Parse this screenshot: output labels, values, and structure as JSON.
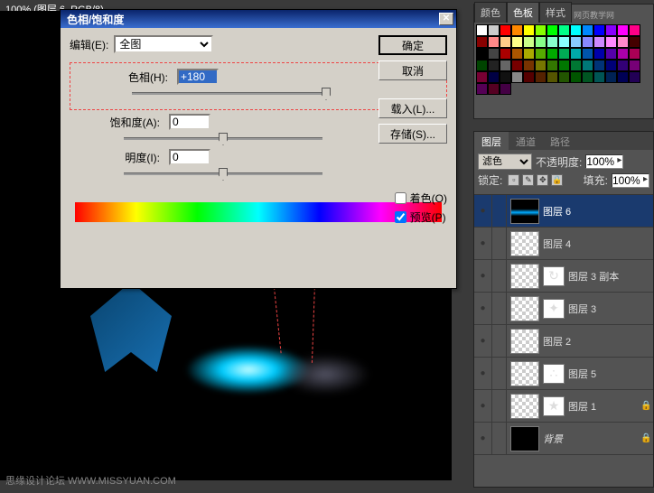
{
  "topbar": "100% (图层 6, RGB/8)",
  "dialog": {
    "title": "色相/饱和度",
    "edit_label": "编辑(E):",
    "edit_value": "全图",
    "hue_label": "色相(H):",
    "hue_value": "+180",
    "sat_label": "饱和度(A):",
    "sat_value": "0",
    "light_label": "明度(I):",
    "light_value": "0",
    "colorize_label": "着色(O)",
    "preview_label": "预览(P)",
    "buttons": {
      "ok": "确定",
      "cancel": "取消",
      "load": "载入(L)...",
      "save": "存储(S)..."
    }
  },
  "swatch_tabs": {
    "color": "颜色",
    "swatch": "色板",
    "style": "样式",
    "ad": "网页教学网"
  },
  "swatch_colors": [
    "#fff",
    "#ccc",
    "#f00",
    "#f80",
    "#ff0",
    "#8f0",
    "#0f0",
    "#0f8",
    "#0ff",
    "#08f",
    "#00f",
    "#80f",
    "#f0f",
    "#f08",
    "#800",
    "#f88",
    "#fc8",
    "#ff8",
    "#cf8",
    "#8f8",
    "#8fc",
    "#8ff",
    "#8cf",
    "#88f",
    "#c8f",
    "#f8f",
    "#f8c",
    "#400",
    "#000",
    "#444",
    "#a00",
    "#a50",
    "#aa0",
    "#5a0",
    "#0a0",
    "#0a5",
    "#0aa",
    "#05a",
    "#00a",
    "#50a",
    "#a0a",
    "#a05",
    "#040",
    "#222",
    "#666",
    "#700",
    "#730",
    "#770",
    "#370",
    "#070",
    "#073",
    "#077",
    "#037",
    "#007",
    "#307",
    "#707",
    "#703",
    "#004",
    "#111",
    "#888",
    "#500",
    "#520",
    "#550",
    "#250",
    "#050",
    "#052",
    "#055",
    "#025",
    "#005",
    "#205",
    "#505",
    "#502",
    "#404"
  ],
  "layers_panel": {
    "tabs": {
      "layers": "图层",
      "channels": "通道",
      "paths": "路径"
    },
    "blend_label": "",
    "blend_value": "滤色",
    "opacity_label": "不透明度:",
    "opacity_value": "100%",
    "lock_label": "锁定:",
    "fill_label": "填充:",
    "fill_value": "100%",
    "layers": [
      {
        "name": "图层 6",
        "sel": true,
        "thumb": "grad"
      },
      {
        "name": "图层 4",
        "thumb": "check"
      },
      {
        "name": "图层 3 副本",
        "thumb": "check",
        "mask": "↻"
      },
      {
        "name": "图层 3",
        "thumb": "check",
        "mask": "✦"
      },
      {
        "name": "图层 2",
        "thumb": "check"
      },
      {
        "name": "图层 5",
        "thumb": "check",
        "mask": "∴"
      },
      {
        "name": "图层 1",
        "thumb": "check",
        "mask": "★",
        "lock": true
      },
      {
        "name": "背景",
        "thumb": "black",
        "italic": true,
        "lock": true
      }
    ]
  },
  "watermark": "思缘设计论坛 WWW.MISSYUAN.COM"
}
